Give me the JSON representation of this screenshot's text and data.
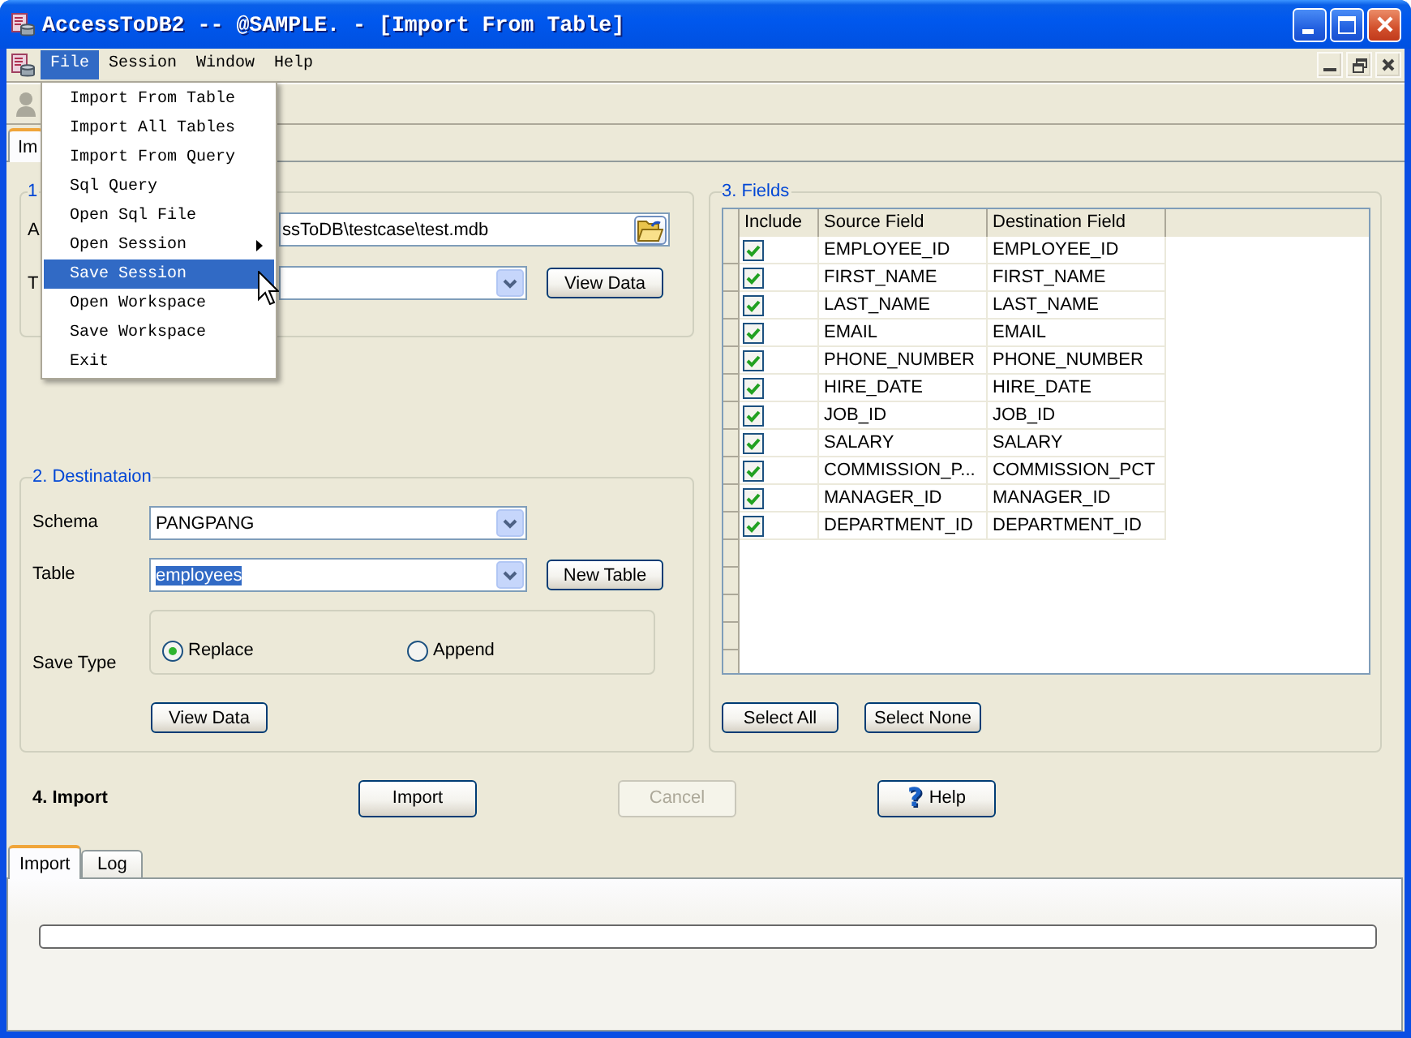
{
  "window": {
    "title": "AccessToDB2 -- @SAMPLE. - [Import From Table]"
  },
  "menu_bar": [
    {
      "label": "File",
      "selected": true
    },
    {
      "label": "Session",
      "selected": false
    },
    {
      "label": "Window",
      "selected": false
    },
    {
      "label": "Help",
      "selected": false
    }
  ],
  "file_menu": [
    {
      "label": "Import From Table",
      "selected": false,
      "submenu": false
    },
    {
      "label": "Import All Tables",
      "selected": false,
      "submenu": false
    },
    {
      "label": "Import From Query",
      "selected": false,
      "submenu": false
    },
    {
      "label": "Sql Query",
      "selected": false,
      "submenu": false
    },
    {
      "label": "Open Sql File",
      "selected": false,
      "submenu": false
    },
    {
      "label": "Open Session",
      "selected": false,
      "submenu": true
    },
    {
      "label": "Save Session",
      "selected": true,
      "submenu": false
    },
    {
      "label": "Open Workspace",
      "selected": false,
      "submenu": false
    },
    {
      "label": "Save Workspace",
      "selected": false,
      "submenu": false
    },
    {
      "label": "Exit",
      "selected": false,
      "submenu": false
    }
  ],
  "top_tabs": [
    {
      "label": "Im",
      "selected": true
    }
  ],
  "source_group": {
    "title": "1",
    "rows": [
      {
        "kind": "file",
        "label": "A",
        "value": "ssToDB\\testcase\\test.mdb"
      },
      {
        "kind": "combo",
        "label": "T",
        "button": "View Data"
      }
    ]
  },
  "destination_group": {
    "title": "2. Destinataion",
    "schema": {
      "label": "Schema",
      "value": "PANGPANG",
      "highlighted": false
    },
    "table": {
      "label": "Table",
      "value": "employees",
      "highlighted": true,
      "button": "New Table"
    },
    "save_type": {
      "label": "Save Type",
      "options": [
        {
          "label": "Replace",
          "selected": true
        },
        {
          "label": "Append",
          "selected": false
        }
      ]
    },
    "view_button": "View Data"
  },
  "fields_group": {
    "title": "3. Fields",
    "columns": [
      "Include",
      "Source Field",
      "Destination Field"
    ],
    "rows": [
      {
        "checked": true,
        "source": "EMPLOYEE_ID",
        "destination": "EMPLOYEE_ID"
      },
      {
        "checked": true,
        "source": "FIRST_NAME",
        "destination": "FIRST_NAME"
      },
      {
        "checked": true,
        "source": "LAST_NAME",
        "destination": "LAST_NAME"
      },
      {
        "checked": true,
        "source": "EMAIL",
        "destination": "EMAIL"
      },
      {
        "checked": true,
        "source": "PHONE_NUMBER",
        "destination": "PHONE_NUMBER"
      },
      {
        "checked": true,
        "source": "HIRE_DATE",
        "destination": "HIRE_DATE"
      },
      {
        "checked": true,
        "source": "JOB_ID",
        "destination": "JOB_ID"
      },
      {
        "checked": true,
        "source": "SALARY",
        "destination": "SALARY"
      },
      {
        "checked": true,
        "source": "COMMISSION_P...",
        "destination": "COMMISSION_PCT"
      },
      {
        "checked": true,
        "source": "MANAGER_ID",
        "destination": "MANAGER_ID"
      },
      {
        "checked": true,
        "source": "DEPARTMENT_ID",
        "destination": "DEPARTMENT_ID"
      }
    ],
    "buttons": [
      "Select All",
      "Select None"
    ]
  },
  "import_section": {
    "title": "4. Import",
    "buttons": [
      {
        "kind": "plain",
        "label": "Import",
        "disabled": false
      },
      {
        "kind": "plain",
        "label": "Cancel",
        "disabled": true
      },
      {
        "kind": "help",
        "icon": "?",
        "label": "Help",
        "disabled": false
      }
    ]
  },
  "bottom_tabs": [
    {
      "label": "Import",
      "selected": true
    },
    {
      "label": "Log",
      "selected": false
    }
  ],
  "progress": {
    "level": 0
  }
}
